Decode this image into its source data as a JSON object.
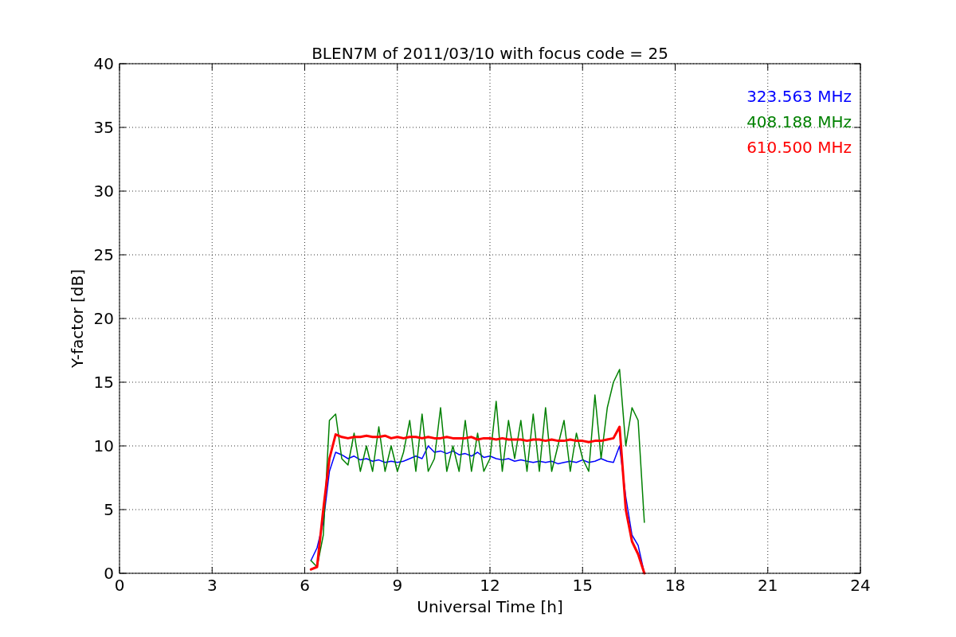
{
  "chart_data": {
    "type": "line",
    "title": "BLEN7M of 2011/03/10 with focus code = 25",
    "xlabel": "Universal Time [h]",
    "ylabel": "Y-factor [dB]",
    "xlim": [
      0,
      24
    ],
    "ylim": [
      0,
      40
    ],
    "xticks": [
      0,
      3,
      6,
      9,
      12,
      15,
      18,
      21,
      24
    ],
    "yticks": [
      0,
      5,
      10,
      15,
      20,
      25,
      30,
      35,
      40
    ],
    "grid": true,
    "x": [
      6.2,
      6.4,
      6.6,
      6.8,
      7.0,
      7.2,
      7.4,
      7.6,
      7.8,
      8.0,
      8.2,
      8.4,
      8.6,
      8.8,
      9.0,
      9.2,
      9.4,
      9.6,
      9.8,
      10.0,
      10.2,
      10.4,
      10.6,
      10.8,
      11.0,
      11.2,
      11.4,
      11.6,
      11.8,
      12.0,
      12.2,
      12.4,
      12.6,
      12.8,
      13.0,
      13.2,
      13.4,
      13.6,
      13.8,
      14.0,
      14.2,
      14.4,
      14.6,
      14.8,
      15.0,
      15.2,
      15.4,
      15.6,
      15.8,
      16.0,
      16.2,
      16.4,
      16.6,
      16.8,
      17.0
    ],
    "series": [
      {
        "name": "323.563 MHz",
        "color": "#0000ff",
        "values": [
          1,
          2,
          4,
          8,
          9.5,
          9.3,
          9,
          9.2,
          8.9,
          9,
          8.8,
          8.9,
          8.7,
          8.8,
          8.7,
          8.8,
          9,
          9.2,
          9,
          10,
          9.5,
          9.6,
          9.4,
          9.6,
          9.3,
          9.4,
          9.2,
          9.5,
          9.1,
          9.2,
          9,
          8.9,
          9,
          8.8,
          8.9,
          8.8,
          8.7,
          8.8,
          8.7,
          8.8,
          8.6,
          8.7,
          8.8,
          8.7,
          8.9,
          8.7,
          8.8,
          9,
          8.8,
          8.7,
          10,
          6,
          3,
          2.2,
          0
        ]
      },
      {
        "name": "408.188 MHz",
        "color": "#008000",
        "values": [
          1,
          0.5,
          3,
          12,
          12.5,
          9,
          8.5,
          11,
          8,
          10,
          8,
          11.5,
          8,
          10,
          8,
          9.5,
          12,
          8,
          12.5,
          8,
          9,
          13,
          8,
          10,
          8,
          12,
          8,
          11,
          8,
          9,
          13.5,
          8,
          12,
          9,
          12,
          8,
          12.5,
          8,
          13,
          8,
          10,
          12,
          8,
          11,
          9,
          8,
          14,
          9,
          13,
          15,
          16,
          10,
          13,
          12,
          4
        ]
      },
      {
        "name": "610.500 MHz",
        "color": "#ff0000",
        "values": [
          0.3,
          0.5,
          5,
          9,
          10.9,
          10.7,
          10.6,
          10.7,
          10.7,
          10.8,
          10.7,
          10.7,
          10.8,
          10.6,
          10.7,
          10.6,
          10.7,
          10.7,
          10.6,
          10.7,
          10.6,
          10.6,
          10.7,
          10.6,
          10.6,
          10.6,
          10.7,
          10.5,
          10.6,
          10.6,
          10.5,
          10.6,
          10.5,
          10.5,
          10.5,
          10.4,
          10.5,
          10.5,
          10.4,
          10.5,
          10.4,
          10.4,
          10.5,
          10.4,
          10.4,
          10.3,
          10.4,
          10.4,
          10.5,
          10.6,
          11.5,
          5,
          2.5,
          1.5,
          0
        ]
      }
    ]
  }
}
